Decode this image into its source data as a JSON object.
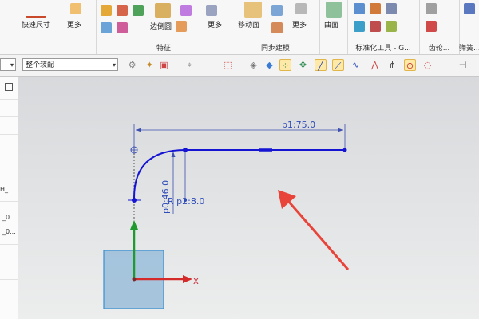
{
  "ribbon": {
    "quick_dim": "快速尺寸",
    "more1": "更多",
    "feature": "特征",
    "edge_round": "边倒圆",
    "more2": "更多",
    "move_face": "移动面",
    "sync_model": "同步建模",
    "more3": "更多",
    "surface": "曲面",
    "std_tools": "标准化工具 - G...",
    "gear": "齿轮...",
    "spring": "弹簧..."
  },
  "toolbar": {
    "filter_value": "",
    "assembly_scope": "整个装配"
  },
  "left_panel": {
    "item1": "H_...",
    "item2": "_0...",
    "item3": "_0..."
  },
  "sketch": {
    "dim_length": "p1:75.0",
    "dim_height": "p0:46.0",
    "dim_radius": "R p2:8.0",
    "axis_x": "X"
  },
  "colors": {
    "sketch_curve": "#1414d2",
    "dimension": "#2f4cb8",
    "axis_x": "#d42a2a",
    "axis_y": "#1e9a2e",
    "arrow": "#e8443a",
    "cube": "#8fb8d8"
  }
}
